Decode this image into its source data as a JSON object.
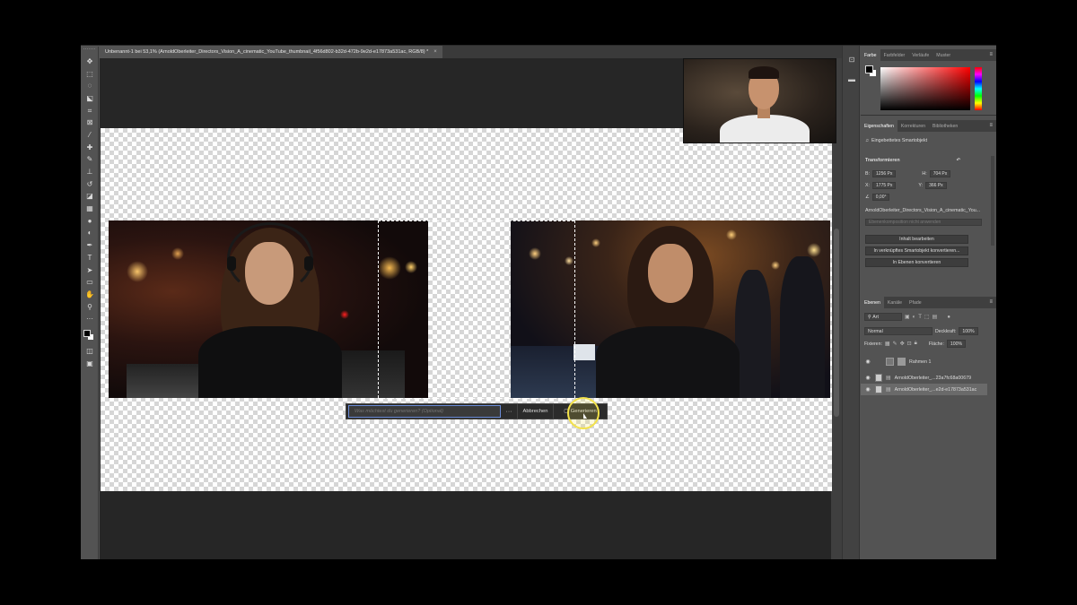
{
  "document": {
    "tab_title": "Unbenannt-1 bei 53,1% (ArnoldOberleiter_Directors_Vision_A_cinematic_YouTube_thumbnail_4f56d802-b32d-472b-9e2d-e17873a531ac, RGB/8) *",
    "close": "×"
  },
  "toolbar": {
    "tools": [
      {
        "name": "move-tool-icon",
        "glyph": "✥"
      },
      {
        "name": "marquee-tool-icon",
        "glyph": "⬚"
      },
      {
        "name": "lasso-tool-icon",
        "glyph": "◌"
      },
      {
        "name": "object-select-tool-icon",
        "glyph": "⬕"
      },
      {
        "name": "crop-tool-icon",
        "glyph": "⌗"
      },
      {
        "name": "frame-tool-icon",
        "glyph": "⊠"
      },
      {
        "name": "eyedropper-tool-icon",
        "glyph": "⁄"
      },
      {
        "name": "healing-brush-tool-icon",
        "glyph": "✚"
      },
      {
        "name": "brush-tool-icon",
        "glyph": "✎"
      },
      {
        "name": "clone-stamp-tool-icon",
        "glyph": "⊥"
      },
      {
        "name": "history-brush-tool-icon",
        "glyph": "↺"
      },
      {
        "name": "eraser-tool-icon",
        "glyph": "◪"
      },
      {
        "name": "gradient-tool-icon",
        "glyph": "▦"
      },
      {
        "name": "blur-tool-icon",
        "glyph": "●"
      },
      {
        "name": "dodge-tool-icon",
        "glyph": "◐"
      },
      {
        "name": "pen-tool-icon",
        "glyph": "✒"
      },
      {
        "name": "type-tool-icon",
        "glyph": "T"
      },
      {
        "name": "path-select-tool-icon",
        "glyph": "➤"
      },
      {
        "name": "rectangle-tool-icon",
        "glyph": "▭"
      },
      {
        "name": "hand-tool-icon",
        "glyph": "✋"
      },
      {
        "name": "zoom-tool-icon",
        "glyph": "⚲"
      },
      {
        "name": "more-tools-icon",
        "glyph": "···"
      }
    ],
    "bottom_tools": [
      {
        "name": "quick-mask-icon",
        "glyph": "◫"
      },
      {
        "name": "screen-mode-icon",
        "glyph": "▣"
      }
    ]
  },
  "gen_bar": {
    "placeholder": "Was möchtest du generieren? (Optional)",
    "more": "···",
    "cancel": "Abbrechen",
    "generate": "Generieren",
    "generate_icon": "▢"
  },
  "side_strip": {
    "icons": [
      {
        "name": "history-panel-icon",
        "glyph": "⊡"
      },
      {
        "name": "comments-panel-icon",
        "glyph": "▬"
      }
    ]
  },
  "color_panel": {
    "tabs": [
      "Farbe",
      "Farbfelder",
      "Verläufe",
      "Muster"
    ],
    "active_tab": 0
  },
  "properties_panel": {
    "tabs": [
      "Eigenschaften",
      "Korrekturen",
      "Bibliotheken"
    ],
    "active_tab": 0,
    "type_label": "Eingebettetes Smartobjekt",
    "section_title": "Transformieren",
    "w_label": "B:",
    "w_value": "1256 Px",
    "h_label": "H:",
    "h_value": "704 Px",
    "x_label": "X:",
    "x_value": "1775 Px",
    "y_label": "Y:",
    "y_value": "366 Px",
    "angle_label": "∠",
    "angle_value": "0,00°",
    "smart_name": "ArnoldOberleiter_Directors_Vision_A_cinematic_You...",
    "layer_comp": "Ebenenkomposition nicht anwenden",
    "btn_edit": "Inhalt bearbeiten",
    "btn_convert_linked": "In verknüpftes Smartobjekt konvertieren...",
    "btn_convert_layers": "In Ebenen konvertieren"
  },
  "layers_panel": {
    "tabs": [
      "Ebenen",
      "Kanäle",
      "Pfade"
    ],
    "active_tab": 0,
    "filter": "Art",
    "blend_mode": "Normal",
    "opacity_label": "Deckkraft:",
    "opacity_value": "100%",
    "lock_label": "Fixieren:",
    "fill_label": "Fläche:",
    "fill_value": "100%",
    "layers": [
      {
        "name": "Rahmen 1",
        "selected": false
      },
      {
        "name": "ArnoldOberleiter_...23a7fc68a00679",
        "selected": false
      },
      {
        "name": "ArnoldOberleiter_...e2d-e17873a531ac",
        "selected": true
      }
    ]
  },
  "colors": {
    "app_bg": "#535353",
    "canvas_bg": "#262626",
    "highlight": "#f3e24a",
    "selection_focus": "#6a8bd6"
  }
}
